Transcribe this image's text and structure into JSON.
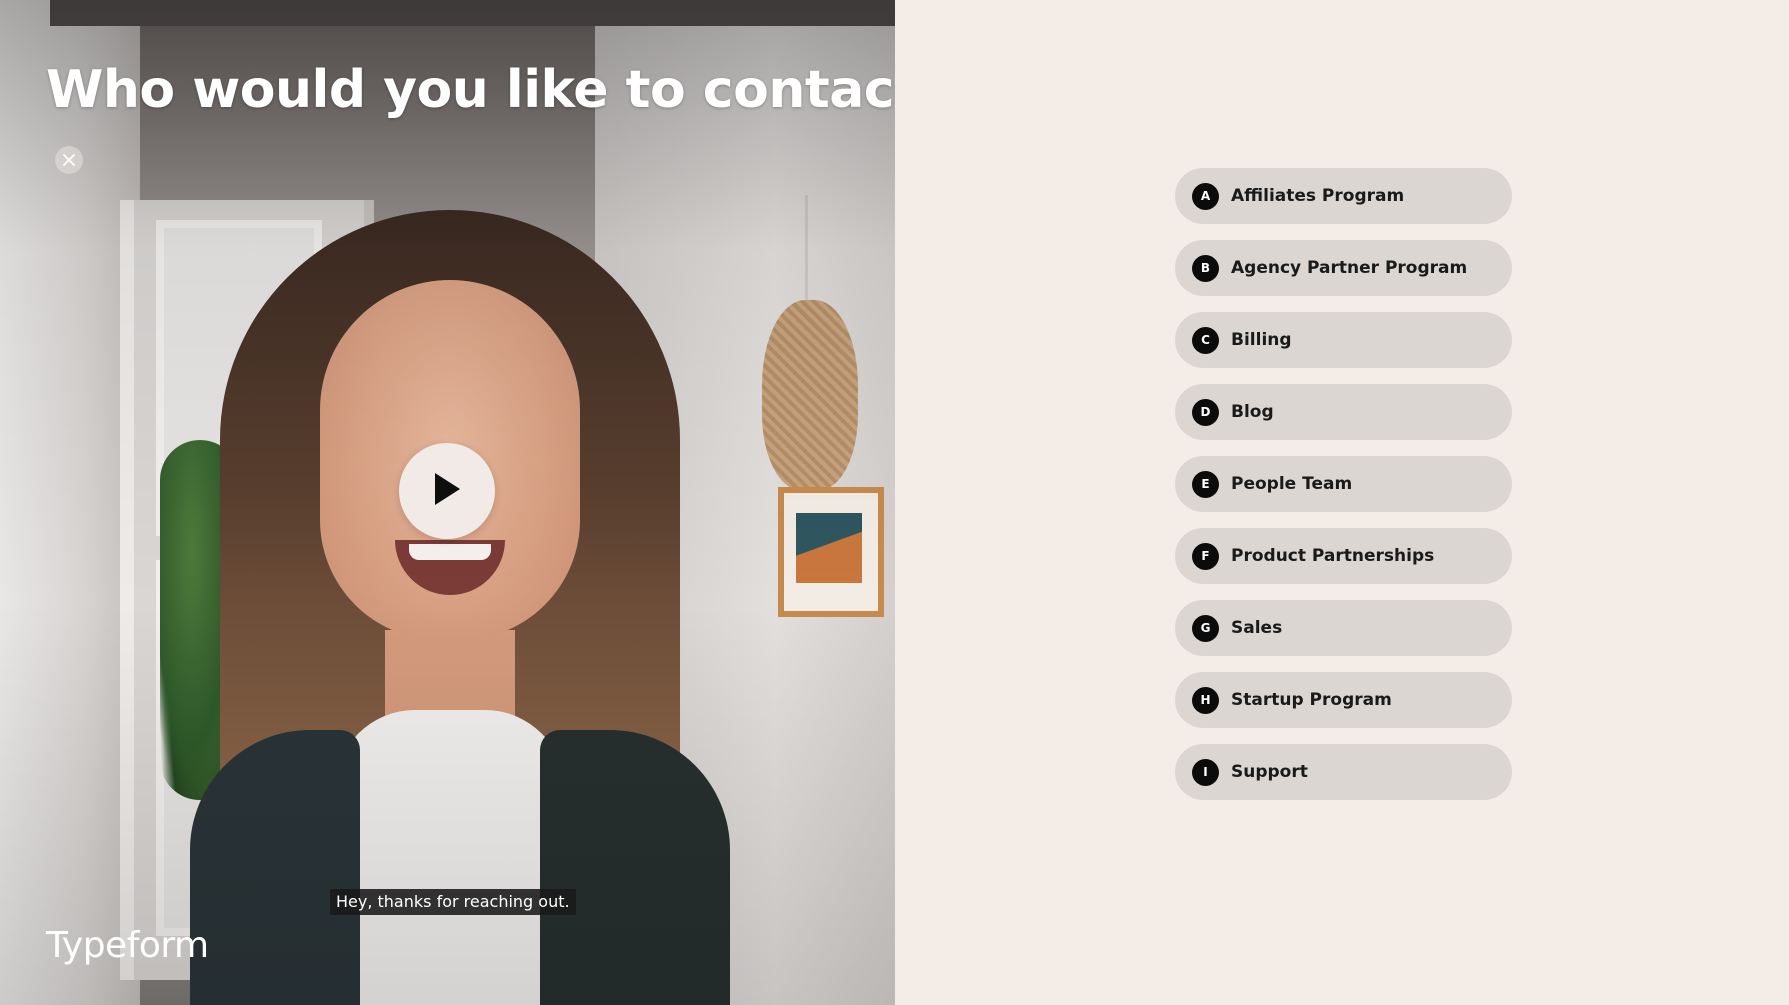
{
  "video": {
    "question": "Who would you like to contact?",
    "caption": "Hey, thanks for reaching out.",
    "close_icon": "close-icon",
    "play_icon": "play-icon"
  },
  "brand": {
    "name": "Typeform"
  },
  "options": [
    {
      "key": "A",
      "label": "Affiliates Program"
    },
    {
      "key": "B",
      "label": "Agency Partner Program"
    },
    {
      "key": "C",
      "label": "Billing"
    },
    {
      "key": "D",
      "label": "Blog"
    },
    {
      "key": "E",
      "label": "People Team"
    },
    {
      "key": "F",
      "label": "Product Partnerships"
    },
    {
      "key": "G",
      "label": "Sales"
    },
    {
      "key": "H",
      "label": "Startup Program"
    },
    {
      "key": "I",
      "label": "Support"
    }
  ],
  "colors": {
    "background": "#f3ece7",
    "option_background": "#dcd6d2",
    "key_badge": "#0b0b0b",
    "text": "#1a1a1a"
  }
}
